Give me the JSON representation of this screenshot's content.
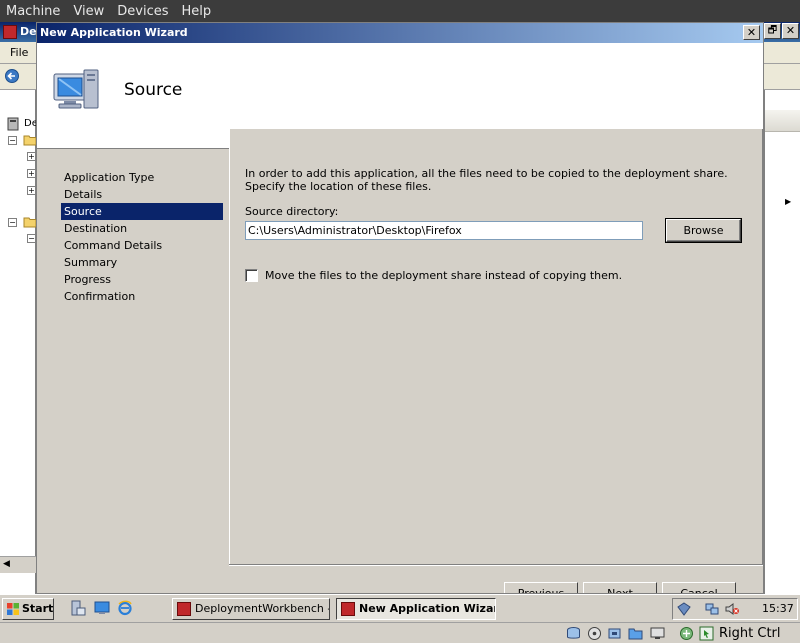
{
  "vbox": {
    "menu": [
      "Machine",
      "View",
      "Devices",
      "Help"
    ],
    "host_key": "Right Ctrl"
  },
  "mmc": {
    "title": "De",
    "restore_glyph": "🗗",
    "close_glyph": "✕",
    "menu_file": "File",
    "tree_label": "De"
  },
  "wizard": {
    "title": "New Application Wizard",
    "close_glyph": "✕",
    "heading": "Source",
    "nav": [
      "Application Type",
      "Details",
      "Source",
      "Destination",
      "Command Details",
      "Summary",
      "Progress",
      "Confirmation"
    ],
    "active_nav_index": 2,
    "description": "In order to add this application, all the files need to be copied to the deployment share.  Specify the location of these files.",
    "source_label": "Source directory:",
    "source_value": "C:\\Users\\Administrator\\Desktop\\Firefox",
    "browse_label": "Browse",
    "move_label": "Move the files to the deployment share instead of copying them.",
    "move_checked": false,
    "buttons": {
      "previous": "Previous",
      "next": "Next",
      "cancel": "Cancel"
    }
  },
  "taskbar": {
    "start_label": "Start",
    "tasks": [
      {
        "label": "DeploymentWorkbench -...",
        "active": false
      },
      {
        "label": "New Application Wizard",
        "active": true
      }
    ],
    "clock": "15:37"
  },
  "colors": {
    "title_active": "#0a246a",
    "selection": "#0a246a",
    "face": "#d4d0c8"
  }
}
